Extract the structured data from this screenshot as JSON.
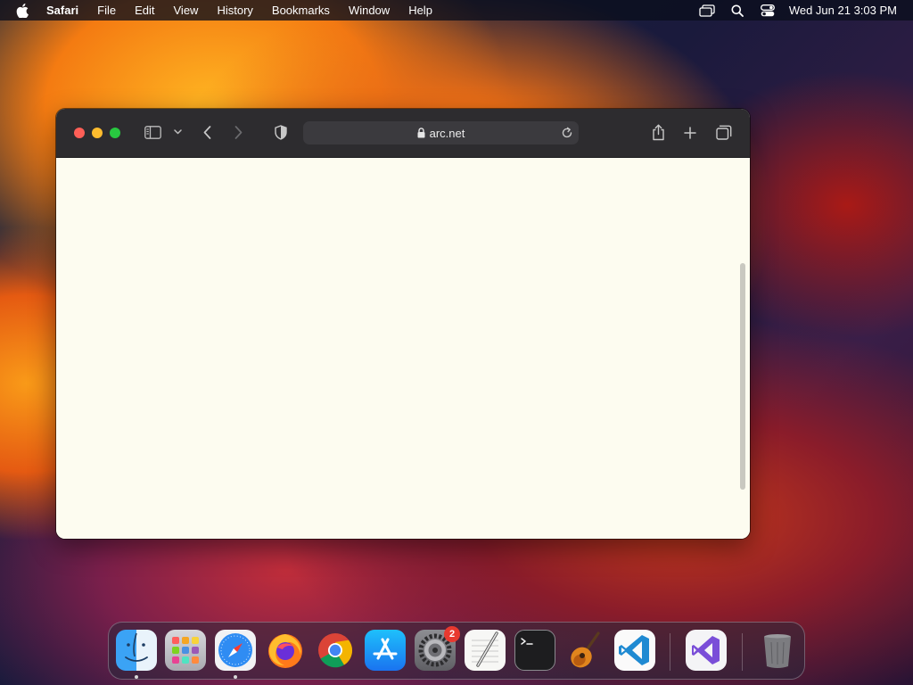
{
  "menubar": {
    "app_name": "Safari",
    "items": [
      "File",
      "Edit",
      "View",
      "History",
      "Bookmarks",
      "Window",
      "Help"
    ],
    "clock": "Wed Jun 21  3:03 PM"
  },
  "browser": {
    "url": "arc.net"
  },
  "dock": {
    "system_settings_badge": "2"
  }
}
